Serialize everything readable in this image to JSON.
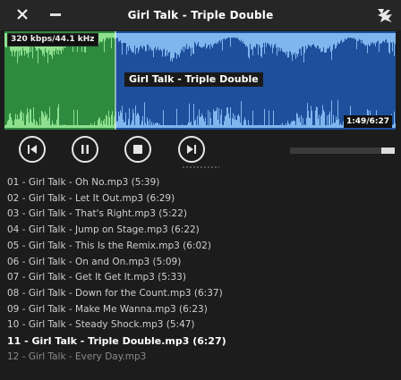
{
  "window": {
    "title": "Girl Talk - Triple Double",
    "close_icon": "close-icon",
    "minimize_icon": "minimize-icon",
    "logo_icon": "app-logo-icon"
  },
  "waveform": {
    "bitrate_label": "320 kbps/44.1 kHz",
    "track_label": "Girl Talk - Triple Double",
    "time_label": "1:49/6:27",
    "progress": 0.283,
    "colors": {
      "played": "#2d8a3f",
      "unplayed": "#1d4f9c",
      "wave_played": "#8ee08e",
      "wave_unplayed": "#7fb6ee"
    }
  },
  "transport": {
    "buttons": [
      {
        "name": "previous-button",
        "icon": "skip-back-icon"
      },
      {
        "name": "pause-button",
        "icon": "pause-icon"
      },
      {
        "name": "stop-button",
        "icon": "stop-icon"
      },
      {
        "name": "next-button",
        "icon": "skip-forward-icon"
      }
    ],
    "volume": 0.13
  },
  "playlist": {
    "items": [
      "01 - Girl Talk - Oh No.mp3 (5:39)",
      "02 - Girl Talk - Let It Out.mp3 (6:29)",
      "03 - Girl Talk - That's Right.mp3 (5:22)",
      "04 - Girl Talk - Jump on Stage.mp3 (6:22)",
      "05 - Girl Talk - This Is the Remix.mp3 (6:02)",
      "06 - Girl Talk - On and On.mp3 (5:09)",
      "07 - Girl Talk - Get It Get It.mp3 (5:33)",
      "08 - Girl Talk - Down for the Count.mp3 (6:37)",
      "09 - Girl Talk - Make Me Wanna.mp3 (6:23)",
      "10 - Girl Talk - Steady Shock.mp3 (5:47)",
      "11 - Girl Talk - Triple Double.mp3 (6:27)",
      "12 - Girl Talk - Every Day.mp3"
    ],
    "current_index": 10
  }
}
